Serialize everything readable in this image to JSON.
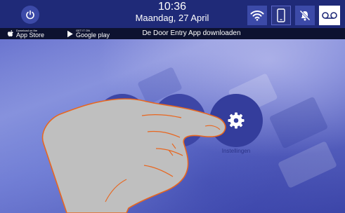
{
  "status_bar": {
    "time": "10:36",
    "date": "Maandag, 27 April",
    "icons": [
      "power-icon",
      "wifi-icon",
      "phone-icon",
      "mute-icon",
      "voicemail-icon"
    ]
  },
  "app_bar": {
    "appstore_small": "Download on the",
    "appstore_big": "App Store",
    "gplay_small": "GET IT ON",
    "gplay_big": "Google play",
    "text": "De Door Entry App downloaden"
  },
  "main": {
    "buttons": [
      {
        "icon": "unlabeled-round-button"
      },
      {
        "icon": "envelope-icon"
      },
      {
        "icon": "gear-icon",
        "label": "Instellingen"
      }
    ]
  },
  "colors": {
    "top_bar": "#1f2a78",
    "app_bar": "#0d1230",
    "button": "#3d46a6",
    "accent_icon": "#3c4aa8"
  }
}
